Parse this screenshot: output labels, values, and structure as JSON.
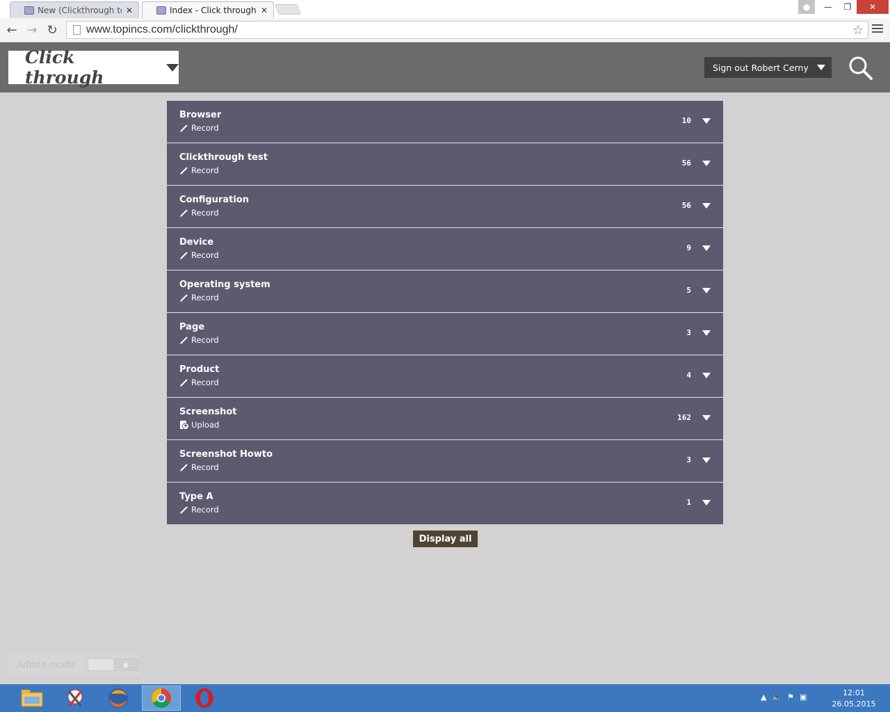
{
  "browser": {
    "tabs": [
      {
        "title": "New (Clickthrough test) -",
        "active": false
      },
      {
        "title": "Index - Click through",
        "active": true
      }
    ],
    "url": "www.topincs.com/clickthrough/"
  },
  "header": {
    "brand": "Click through",
    "signout_label": "Sign out Robert Cerny"
  },
  "list": [
    {
      "title": "Browser",
      "action": "Record",
      "action_icon": "pencil-icon",
      "count": "10"
    },
    {
      "title": "Clickthrough test",
      "action": "Record",
      "action_icon": "pencil-icon",
      "count": "56"
    },
    {
      "title": "Configuration",
      "action": "Record",
      "action_icon": "pencil-icon",
      "count": "56"
    },
    {
      "title": "Device",
      "action": "Record",
      "action_icon": "pencil-icon",
      "count": "9"
    },
    {
      "title": "Operating system",
      "action": "Record",
      "action_icon": "pencil-icon",
      "count": "5"
    },
    {
      "title": "Page",
      "action": "Record",
      "action_icon": "pencil-icon",
      "count": "3"
    },
    {
      "title": "Product",
      "action": "Record",
      "action_icon": "pencil-icon",
      "count": "4"
    },
    {
      "title": "Screenshot",
      "action": "Upload",
      "action_icon": "upload-icon",
      "count": "162"
    },
    {
      "title": "Screenshot Howto",
      "action": "Record",
      "action_icon": "pencil-icon",
      "count": "3"
    },
    {
      "title": "Type A",
      "action": "Record",
      "action_icon": "pencil-icon",
      "count": "1"
    }
  ],
  "display_all_label": "Display all",
  "admin": {
    "label": "Admin mode",
    "enabled": false
  },
  "taskbar": {
    "apps": [
      "file-explorer-icon",
      "snipping-tool-icon",
      "firefox-icon",
      "chrome-icon",
      "opera-icon"
    ],
    "time": "12:01",
    "date": "26.05.2015"
  },
  "colors": {
    "row_bg": "#5b5a6e",
    "header_bg": "#6b6b6b",
    "display_all_bg": "#4d4530",
    "taskbar_bg": "#3b78c0"
  }
}
